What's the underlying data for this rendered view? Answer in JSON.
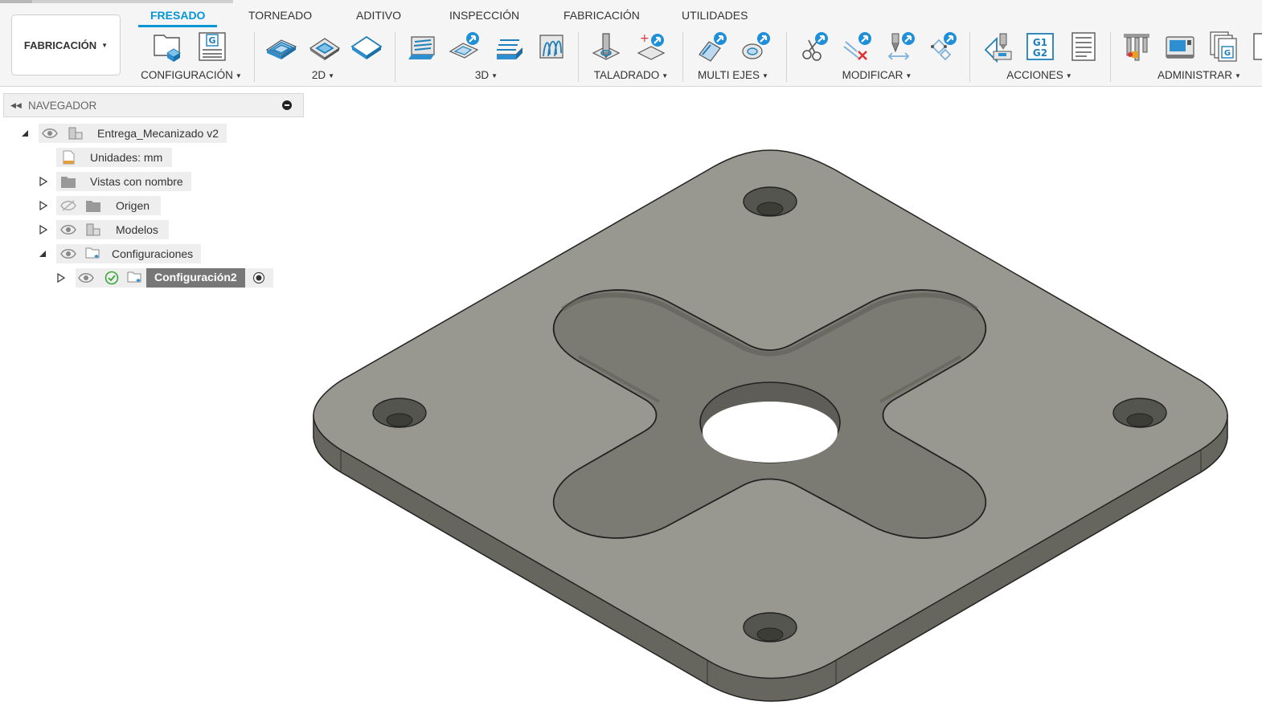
{
  "workspace": {
    "label": "FABRICACIÓN"
  },
  "tabs": [
    {
      "label": "FRESADO",
      "active": true
    },
    {
      "label": "TORNEADO"
    },
    {
      "label": "ADITIVO"
    },
    {
      "label": "INSPECCIÓN"
    },
    {
      "label": "FABRICACIÓN"
    },
    {
      "label": "UTILIDADES"
    }
  ],
  "groups": {
    "configuracion": "CONFIGURACIÓN",
    "d2": "2D",
    "d3": "3D",
    "taladrado": "TALADRADO",
    "multiejes": "MULTI EJES",
    "modificar": "MODIFICAR",
    "acciones": "ACCIONES",
    "administrar": "ADMINISTRAR"
  },
  "icons": {
    "g_badge": "G",
    "g1g2_top": "G1",
    "g1g2_bottom": "G2",
    "g_doc": "G"
  },
  "navigator": {
    "title": "NAVEGADOR",
    "root": "Entrega_Mecanizado v2",
    "units": "Unidades: mm",
    "named_views": "Vistas con nombre",
    "origin": "Origen",
    "models": "Modelos",
    "setups": "Configuraciones",
    "setup2": "Configuración2"
  },
  "colors": {
    "accent": "#0696d7",
    "part_top": "#999890",
    "part_side": "#6b6b63",
    "pocket": "#7c7b73"
  }
}
